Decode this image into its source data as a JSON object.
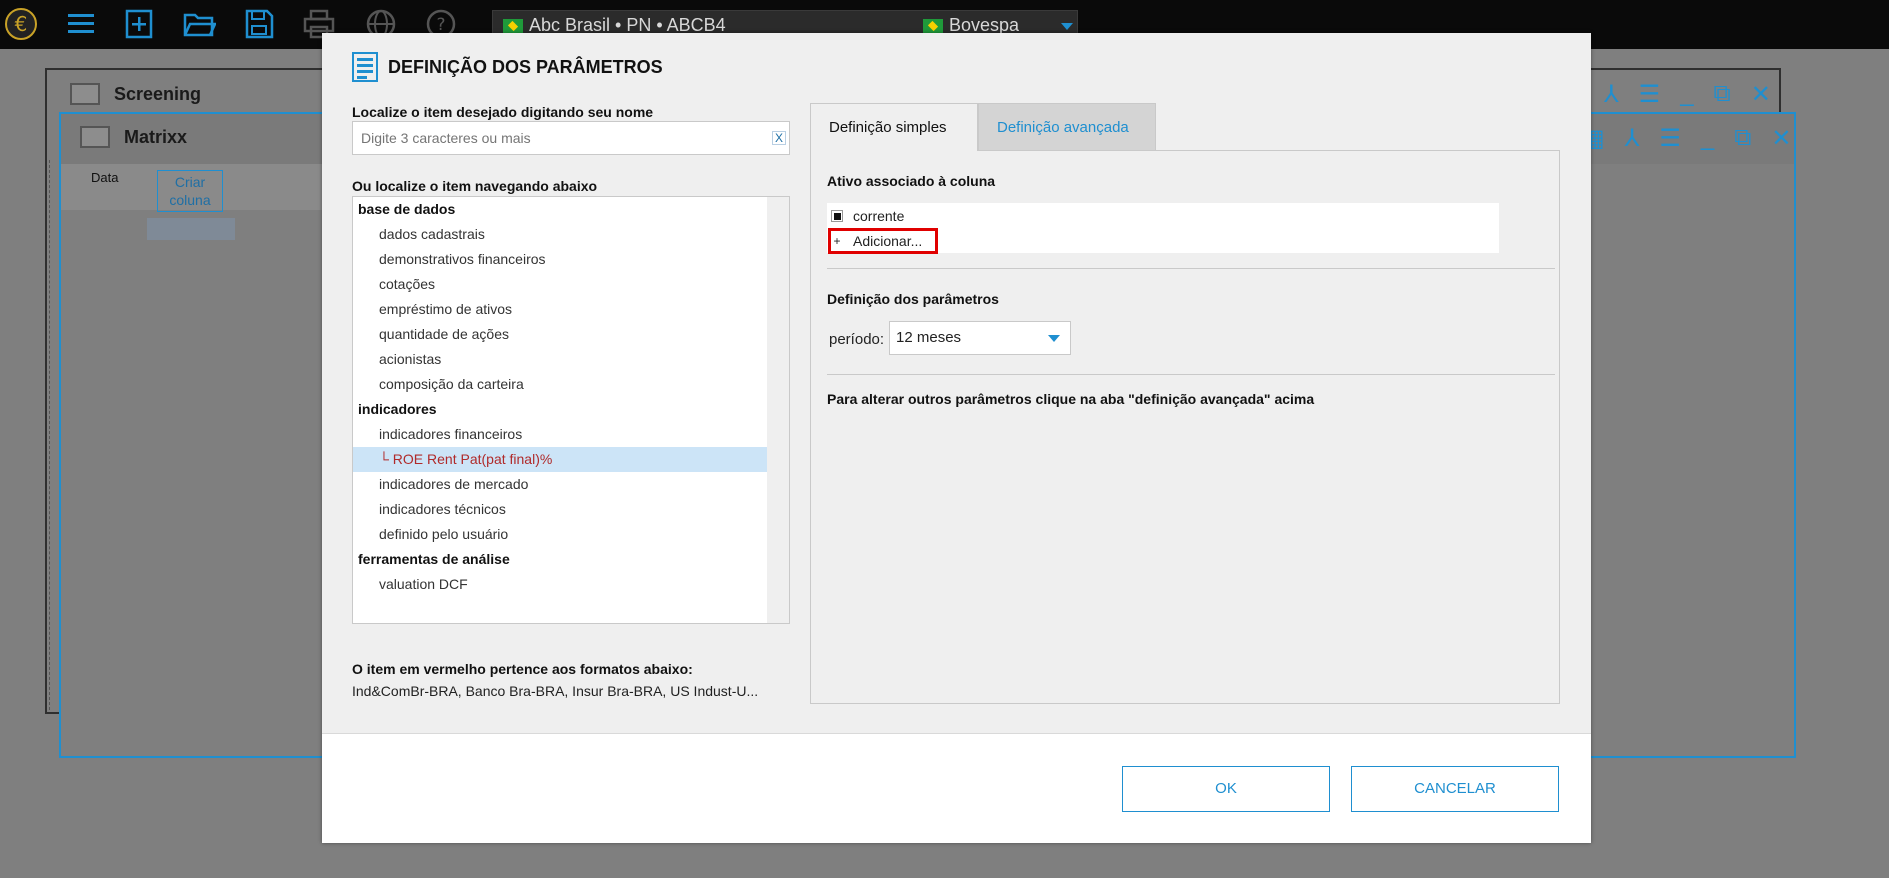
{
  "toolbar": {
    "icons": [
      "euro-logo",
      "menu",
      "new",
      "open",
      "save",
      "print",
      "globe",
      "help"
    ],
    "asset": "Abc Brasil • PN • ABCB4",
    "exchange": "Bovespa"
  },
  "windows": {
    "screening_title": "Screening",
    "matrixx_title": "Matrixx",
    "matrixx_col_data": "Data",
    "matrixx_criar_coluna": "Criar coluna"
  },
  "modal": {
    "title": "DEFINIÇÃO DOS PARÂMETROS",
    "search_label": "Localize o item desejado digitando seu nome",
    "search_placeholder": "Digite 3 caracteres ou mais",
    "search_clear": "X",
    "browse_label": "Ou localize o item navegando abaixo",
    "tree": [
      {
        "type": "cat",
        "label": "base de dados"
      },
      {
        "type": "sub",
        "label": "dados cadastrais"
      },
      {
        "type": "sub",
        "label": "demonstrativos financeiros"
      },
      {
        "type": "sub",
        "label": "cotações"
      },
      {
        "type": "sub",
        "label": "empréstimo de ativos"
      },
      {
        "type": "sub",
        "label": "quantidade de ações"
      },
      {
        "type": "sub",
        "label": "acionistas"
      },
      {
        "type": "sub",
        "label": "composição da carteira"
      },
      {
        "type": "cat",
        "label": "indicadores"
      },
      {
        "type": "sub",
        "label": "indicadores financeiros"
      },
      {
        "type": "sel",
        "label": "└ ROE Rent Pat(pat final)%"
      },
      {
        "type": "sub",
        "label": "indicadores de mercado"
      },
      {
        "type": "sub",
        "label": "indicadores técnicos"
      },
      {
        "type": "sub",
        "label": "definido pelo usuário"
      },
      {
        "type": "cat",
        "label": "ferramentas de análise"
      },
      {
        "type": "sub",
        "label": "valuation DCF"
      }
    ],
    "red_item_label": "O item em vermelho pertence aos formatos abaixo:",
    "red_item_formats": "Ind&ComBr-BRA, Banco Bra-BRA, Insur Bra-BRA, US Indust-U...",
    "tabs": {
      "simple": "Definição simples",
      "advanced": "Definição avançada"
    },
    "asset_section_title": "Ativo associado à coluna",
    "asset_current": "corrente",
    "asset_add": "Adicionar...",
    "param_section_title": "Definição dos parâmetros",
    "periodo_label": "período:",
    "periodo_value": "12 meses",
    "advanced_note": "Para alterar outros parâmetros clique na aba \"definição avançada\" acima",
    "ok": "OK",
    "cancel": "CANCELAR"
  },
  "colors": {
    "accent": "#1f8fd0",
    "selected_row": "#cce4f7",
    "red_item": "#b02a2a",
    "highlight_box": "#e00000"
  }
}
